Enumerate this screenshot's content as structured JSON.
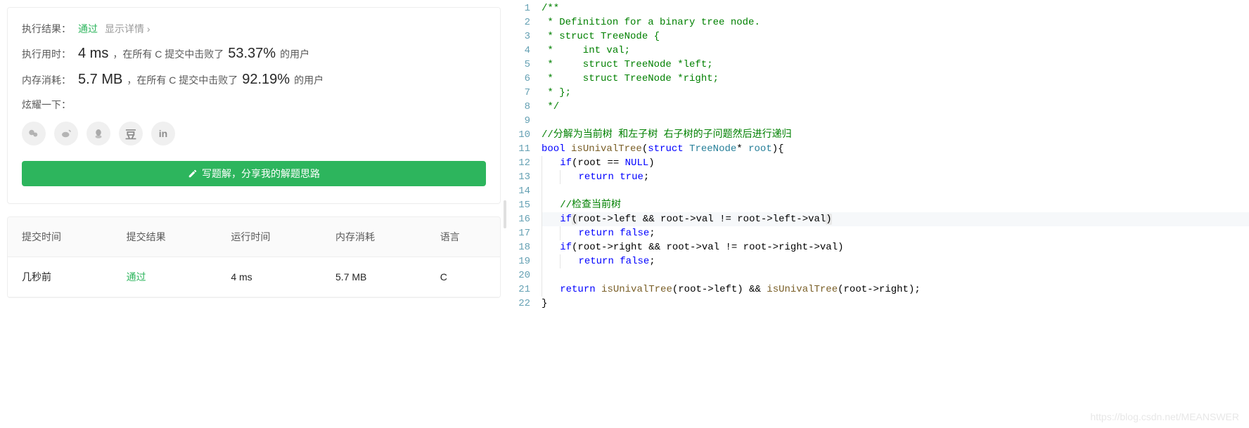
{
  "result": {
    "label": "执行结果：",
    "status": "通过",
    "show_detail": "显示详情 ›",
    "runtime_label": "执行用时：",
    "runtime_value": "4 ms",
    "runtime_text1": "，在所有 C 提交中击败了",
    "runtime_pct": "53.37%",
    "runtime_text2": "的用户",
    "memory_label": "内存消耗：",
    "memory_value": "5.7 MB",
    "memory_text1": "，在所有 C 提交中击败了",
    "memory_pct": "92.19%",
    "memory_text2": "的用户",
    "share_label": "炫耀一下：",
    "write_solution": "写题解，分享我的解题思路"
  },
  "share_icons": [
    "wechat-icon",
    "weibo-icon",
    "qq-icon",
    "douban-icon",
    "linkedin-icon"
  ],
  "table": {
    "headers": [
      "提交时间",
      "提交结果",
      "运行时间",
      "内存消耗",
      "语言"
    ],
    "row": {
      "time": "几秒前",
      "result": "通过",
      "runtime": "4 ms",
      "memory": "5.7 MB",
      "lang": "C"
    }
  },
  "code": {
    "lines": [
      {
        "n": 1,
        "segs": [
          {
            "cls": "tok-comment",
            "t": "/**"
          }
        ]
      },
      {
        "n": 2,
        "segs": [
          {
            "cls": "tok-comment",
            "t": " * Definition for a binary tree node."
          }
        ]
      },
      {
        "n": 3,
        "segs": [
          {
            "cls": "tok-comment",
            "t": " * struct TreeNode {"
          }
        ]
      },
      {
        "n": 4,
        "segs": [
          {
            "cls": "tok-comment",
            "t": " *     int val;"
          }
        ]
      },
      {
        "n": 5,
        "segs": [
          {
            "cls": "tok-comment",
            "t": " *     struct TreeNode *left;"
          }
        ]
      },
      {
        "n": 6,
        "segs": [
          {
            "cls": "tok-comment",
            "t": " *     struct TreeNode *right;"
          }
        ]
      },
      {
        "n": 7,
        "segs": [
          {
            "cls": "tok-comment",
            "t": " * };"
          }
        ]
      },
      {
        "n": 8,
        "segs": [
          {
            "cls": "tok-comment",
            "t": " */"
          }
        ]
      },
      {
        "n": 9,
        "segs": []
      },
      {
        "n": 10,
        "segs": [
          {
            "cls": "tok-comment",
            "t": "//分解为当前树 和左子树 右子树的子问题然后进行递归"
          }
        ]
      },
      {
        "n": 11,
        "segs": [
          {
            "cls": "tok-keyword",
            "t": "bool"
          },
          {
            "cls": "tok-black",
            "t": " "
          },
          {
            "cls": "tok-func",
            "t": "isUnivalTree"
          },
          {
            "cls": "tok-black",
            "t": "("
          },
          {
            "cls": "tok-keyword",
            "t": "struct"
          },
          {
            "cls": "tok-black",
            "t": " "
          },
          {
            "cls": "tok-type",
            "t": "TreeNode"
          },
          {
            "cls": "tok-black",
            "t": "* "
          },
          {
            "cls": "tok-type",
            "t": "root"
          },
          {
            "cls": "tok-black",
            "t": "){"
          }
        ]
      },
      {
        "n": 12,
        "indent": 1,
        "segs": [
          {
            "cls": "tok-keyword",
            "t": "if"
          },
          {
            "cls": "tok-black",
            "t": "(root == "
          },
          {
            "cls": "tok-const",
            "t": "NULL"
          },
          {
            "cls": "tok-black",
            "t": ")"
          }
        ]
      },
      {
        "n": 13,
        "indent": 2,
        "segs": [
          {
            "cls": "tok-keyword",
            "t": "return"
          },
          {
            "cls": "tok-black",
            "t": " "
          },
          {
            "cls": "tok-const",
            "t": "true"
          },
          {
            "cls": "tok-black",
            "t": ";"
          }
        ]
      },
      {
        "n": 14,
        "indent": 1,
        "segs": []
      },
      {
        "n": 15,
        "indent": 1,
        "segs": [
          {
            "cls": "tok-comment",
            "t": "//检查当前树"
          }
        ]
      },
      {
        "n": 16,
        "indent": 1,
        "cursor": true,
        "segs": [
          {
            "cls": "tok-keyword",
            "t": "if"
          },
          {
            "cls": "tok-black bracket-hl",
            "t": "("
          },
          {
            "cls": "tok-black",
            "t": "root->left && root->val != root->left->val"
          },
          {
            "cls": "tok-black bracket-hl",
            "t": ")"
          }
        ]
      },
      {
        "n": 17,
        "indent": 2,
        "segs": [
          {
            "cls": "tok-keyword",
            "t": "return"
          },
          {
            "cls": "tok-black",
            "t": " "
          },
          {
            "cls": "tok-const",
            "t": "false"
          },
          {
            "cls": "tok-black",
            "t": ";"
          }
        ]
      },
      {
        "n": 18,
        "indent": 1,
        "segs": [
          {
            "cls": "tok-keyword",
            "t": "if"
          },
          {
            "cls": "tok-black",
            "t": "(root->right && root->val != root->right->val)"
          }
        ]
      },
      {
        "n": 19,
        "indent": 2,
        "segs": [
          {
            "cls": "tok-keyword",
            "t": "return"
          },
          {
            "cls": "tok-black",
            "t": " "
          },
          {
            "cls": "tok-const",
            "t": "false"
          },
          {
            "cls": "tok-black",
            "t": ";"
          }
        ]
      },
      {
        "n": 20,
        "indent": 1,
        "segs": []
      },
      {
        "n": 21,
        "indent": 1,
        "segs": [
          {
            "cls": "tok-keyword",
            "t": "return"
          },
          {
            "cls": "tok-black",
            "t": " "
          },
          {
            "cls": "tok-func",
            "t": "isUnivalTree"
          },
          {
            "cls": "tok-black",
            "t": "(root->left) && "
          },
          {
            "cls": "tok-func",
            "t": "isUnivalTree"
          },
          {
            "cls": "tok-black",
            "t": "(root->right);"
          }
        ]
      },
      {
        "n": 22,
        "segs": [
          {
            "cls": "tok-black",
            "t": "}"
          }
        ]
      }
    ]
  },
  "watermark": "https://blog.csdn.net/MEANSWER"
}
